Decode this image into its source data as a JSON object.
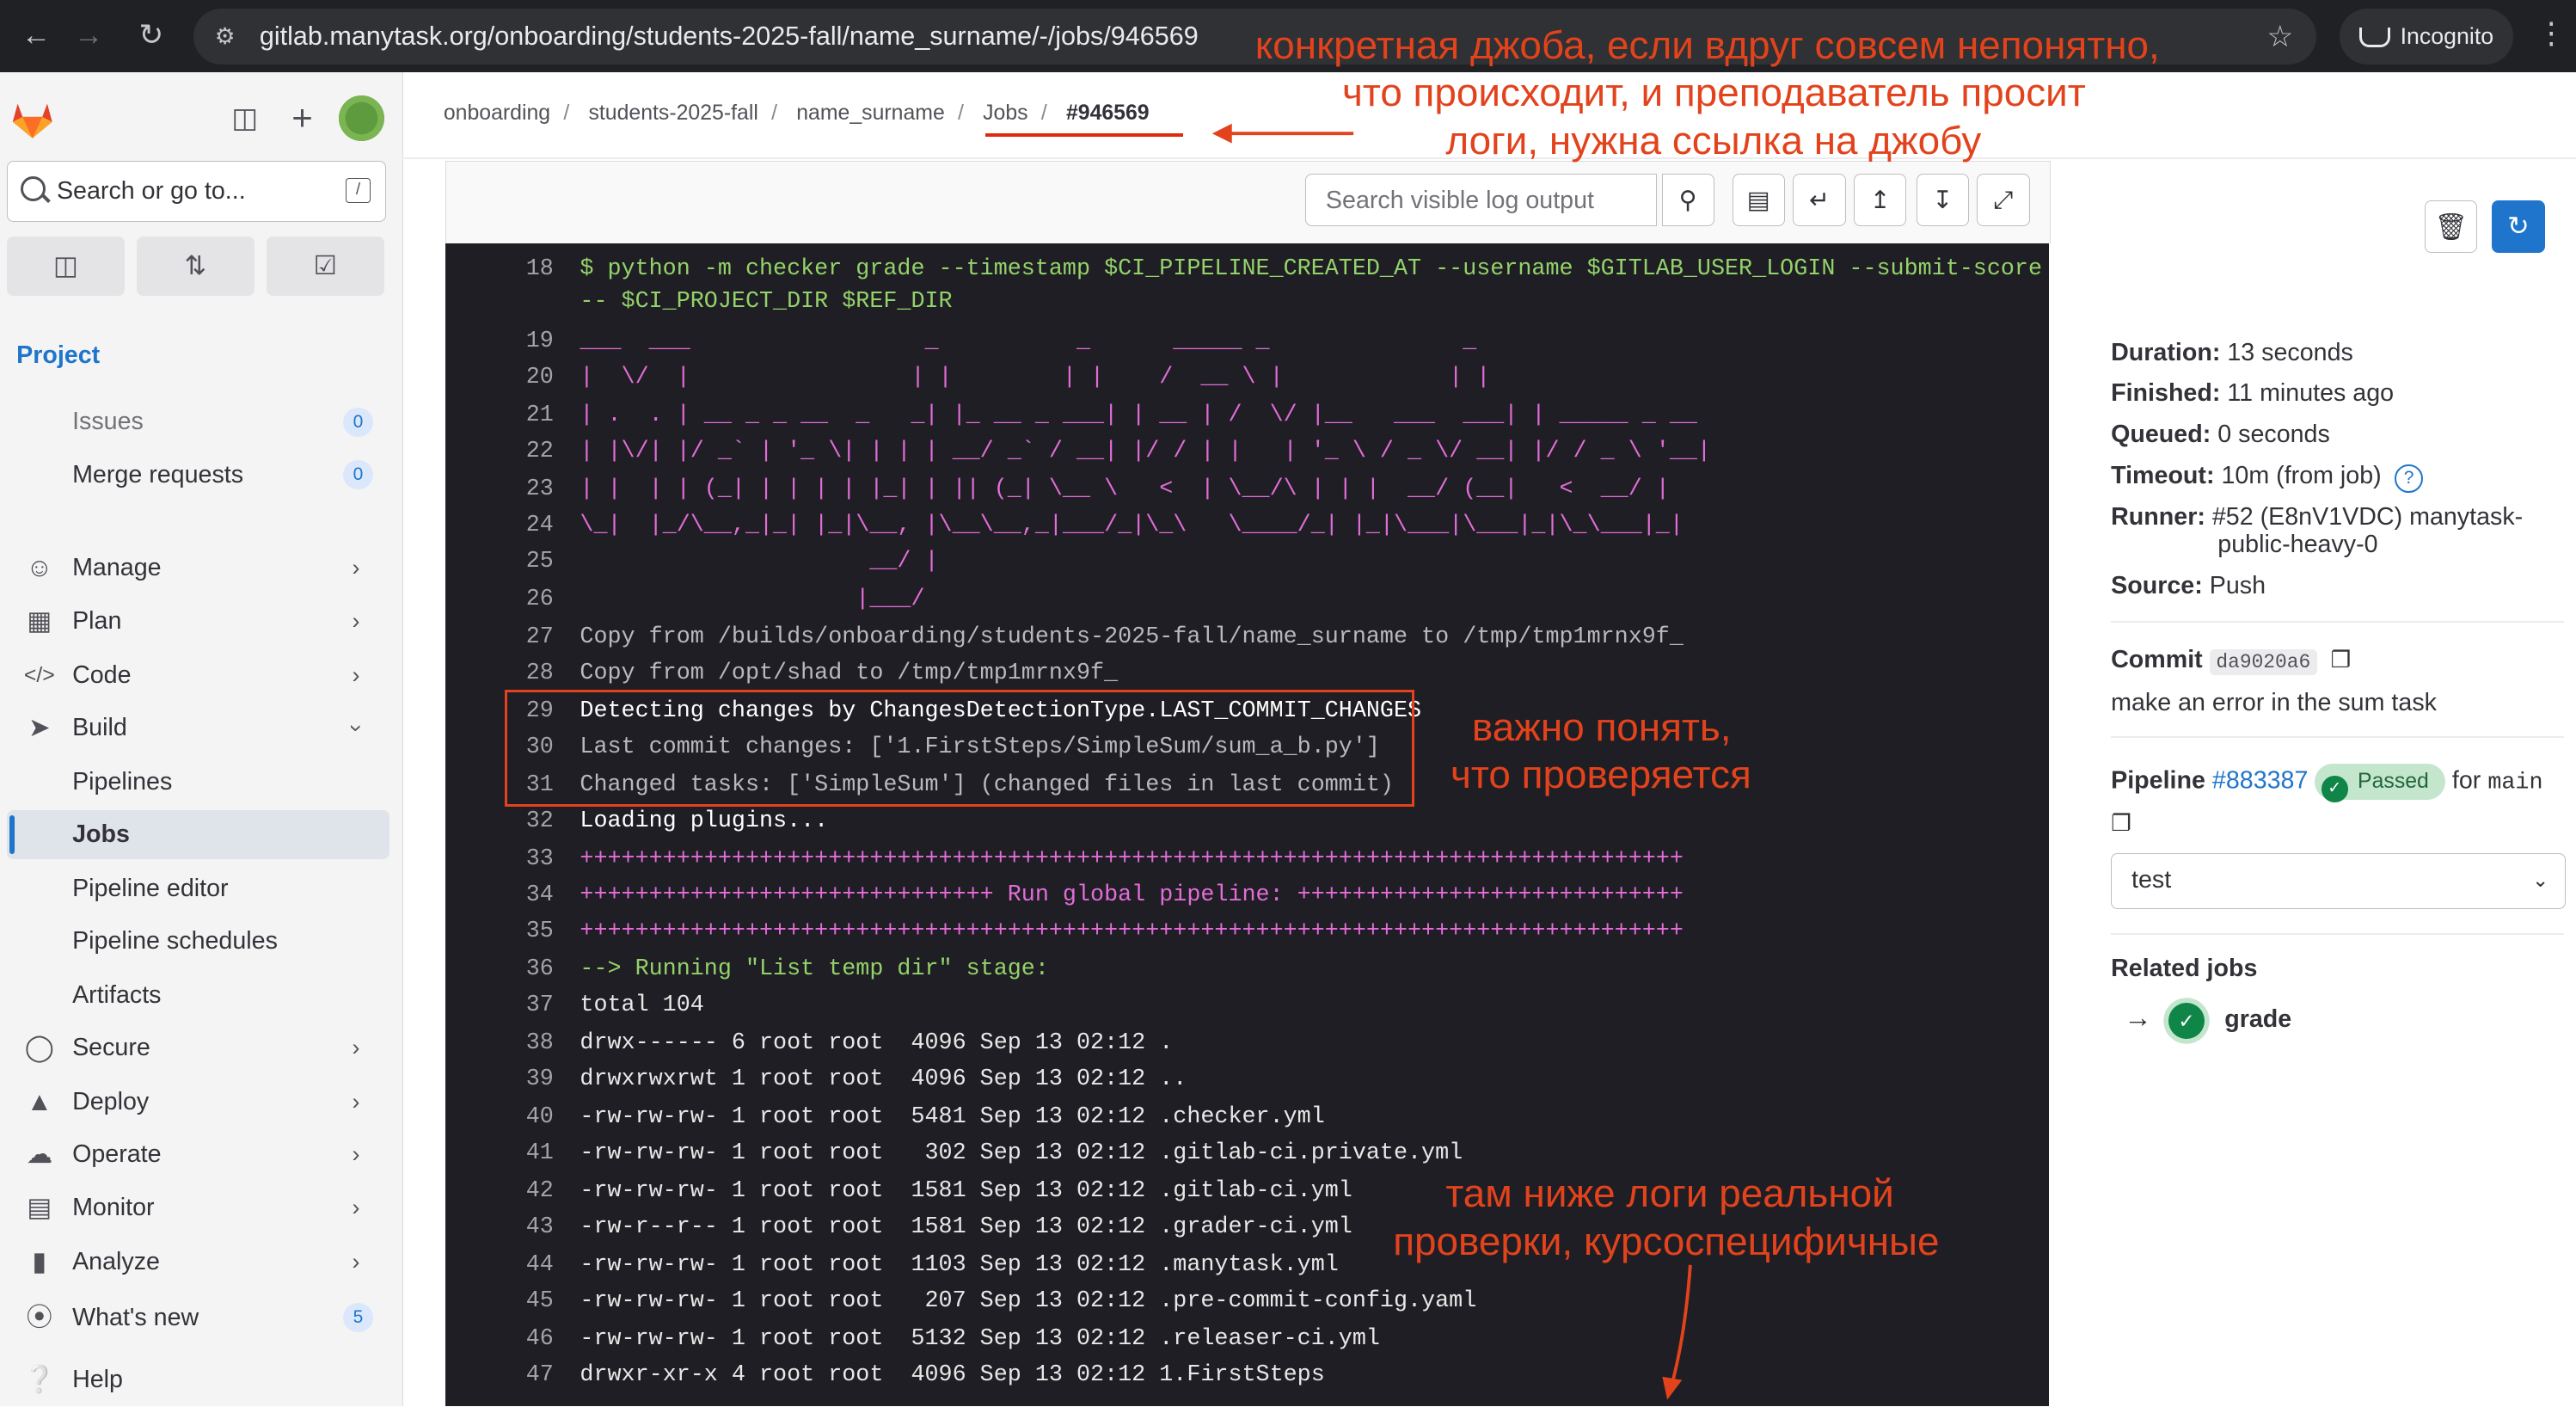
{
  "browser": {
    "url": "gitlab.manytask.org/onboarding/students-2025-fall/name_surname/-/jobs/946569",
    "profile_label": "Incognito"
  },
  "sidebar": {
    "search_placeholder": "Search or go to...",
    "search_shortcut": "/",
    "section_title": "Project",
    "items": [
      {
        "label": "Issues",
        "badge": "0"
      },
      {
        "label": "Merge requests",
        "badge": "0"
      },
      {
        "label": "Manage"
      },
      {
        "label": "Plan"
      },
      {
        "label": "Code"
      },
      {
        "label": "Build"
      },
      {
        "label": "Pipelines"
      },
      {
        "label": "Jobs"
      },
      {
        "label": "Pipeline editor"
      },
      {
        "label": "Pipeline schedules"
      },
      {
        "label": "Artifacts"
      },
      {
        "label": "Secure"
      },
      {
        "label": "Deploy"
      },
      {
        "label": "Operate"
      },
      {
        "label": "Monitor"
      },
      {
        "label": "Analyze"
      },
      {
        "label": "What's new",
        "badge": "5"
      },
      {
        "label": "Help"
      }
    ]
  },
  "breadcrumbs": [
    "onboarding",
    "students-2025-fall",
    "name_surname",
    "Jobs",
    "#946569"
  ],
  "log": {
    "search_placeholder": "Search visible log output",
    "lines": [
      {
        "n": "18",
        "text": "$ python -m checker grade --timestamp $CI_PIPELINE_CREATED_AT --username $GITLAB_USER_LOGIN --submit-score",
        "style": "green"
      },
      {
        "n": "",
        "text": "-- $CI_PROJECT_DIR $REF_DIR",
        "style": "green"
      },
      {
        "n": "19",
        "text": "___  ___                 _          _      _____ _              _",
        "style": "mag"
      },
      {
        "n": "20",
        "text": "|  \\/  |                | |        | |    /  __ \\ |            | |",
        "style": "mag"
      },
      {
        "n": "21",
        "text": "| .  . | __ _ _ __  _   _| |_ __ _ ___| | __ | /  \\/ |__   ___  ___| | _____ _ __",
        "style": "mag"
      },
      {
        "n": "22",
        "text": "| |\\/| |/ _` | '_ \\| | | | __/ _` / __| |/ / | |   | '_ \\ / _ \\/ __| |/ / _ \\ '__|",
        "style": "mag"
      },
      {
        "n": "23",
        "text": "| |  | | (_| | | | | |_| | || (_| \\__ \\   <  | \\__/\\ | | |  __/ (__|   <  __/ |",
        "style": "mag"
      },
      {
        "n": "24",
        "text": "\\_|  |_/\\__,_|_| |_|\\__, |\\__\\__,_|___/_|\\_\\   \\____/_| |_|\\___|\\___|_|\\_\\___|_|",
        "style": "mag"
      },
      {
        "n": "25",
        "text": "                     __/ |",
        "style": "mag"
      },
      {
        "n": "26",
        "text": "                    |___/",
        "style": "mag"
      },
      {
        "n": "27",
        "text": "Copy from /builds/onboarding/students-2025-fall/name_surname to /tmp/tmp1mrnx9f_",
        "style": "dim"
      },
      {
        "n": "28",
        "text": "Copy from /opt/shad to /tmp/tmp1mrnx9f_",
        "style": "dim"
      },
      {
        "n": "29",
        "text": "Detecting changes by ChangesDetectionType.LAST_COMMIT_CHANGES",
        "style": "bold"
      },
      {
        "n": "30",
        "text": "Last commit changes: ['1.FirstSteps/SimpleSum/sum_a_b.py']",
        "style": "dim"
      },
      {
        "n": "31",
        "text": "Changed tasks: ['SimpleSum'] (changed files in last commit)",
        "style": "dim"
      },
      {
        "n": "32",
        "text": "Loading plugins...",
        "style": "bold"
      },
      {
        "n": "33",
        "text": "++++++++++++++++++++++++++++++++++++++++++++++++++++++++++++++++++++++++++++++++",
        "style": "mag"
      },
      {
        "n": "34",
        "text": "++++++++++++++++++++++++++++++ Run global pipeline: ++++++++++++++++++++++++++++",
        "style": "mag"
      },
      {
        "n": "35",
        "text": "++++++++++++++++++++++++++++++++++++++++++++++++++++++++++++++++++++++++++++++++",
        "style": "mag"
      },
      {
        "n": "36",
        "text": "--> Running \"List temp dir\" stage:",
        "style": "green"
      },
      {
        "n": "37",
        "text": "total 104",
        "style": "normal"
      },
      {
        "n": "38",
        "text": "drwx------ 6 root root  4096 Sep 13 02:12 .",
        "style": "normal"
      },
      {
        "n": "39",
        "text": "drwxrwxrwt 1 root root  4096 Sep 13 02:12 ..",
        "style": "normal"
      },
      {
        "n": "40",
        "text": "-rw-rw-rw- 1 root root  5481 Sep 13 02:12 .checker.yml",
        "style": "normal"
      },
      {
        "n": "41",
        "text": "-rw-rw-rw- 1 root root   302 Sep 13 02:12 .gitlab-ci.private.yml",
        "style": "normal"
      },
      {
        "n": "42",
        "text": "-rw-rw-rw- 1 root root  1581 Sep 13 02:12 .gitlab-ci.yml",
        "style": "normal"
      },
      {
        "n": "43",
        "text": "-rw-r--r-- 1 root root  1581 Sep 13 02:12 .grader-ci.yml",
        "style": "normal"
      },
      {
        "n": "44",
        "text": "-rw-rw-rw- 1 root root  1103 Sep 13 02:12 .manytask.yml",
        "style": "normal"
      },
      {
        "n": "45",
        "text": "-rw-rw-rw- 1 root root   207 Sep 13 02:12 .pre-commit-config.yaml",
        "style": "normal"
      },
      {
        "n": "46",
        "text": "-rw-rw-rw- 1 root root  5132 Sep 13 02:12 .releaser-ci.yml",
        "style": "normal"
      },
      {
        "n": "47",
        "text": "drwxr-xr-x 4 root root  4096 Sep 13 02:12 1.FirstSteps",
        "style": "normal"
      }
    ]
  },
  "job": {
    "duration_label": "Duration:",
    "duration": "13 seconds",
    "finished_label": "Finished:",
    "finished": "11 minutes ago",
    "queued_label": "Queued:",
    "queued": "0 seconds",
    "timeout_label": "Timeout:",
    "timeout": "10m (from job)",
    "runner_label": "Runner:",
    "runner_1": "#52 (E8nV1VDC) manytask-",
    "runner_2": "public-heavy-0",
    "source_label": "Source:",
    "source": "Push",
    "commit_label": "Commit",
    "commit_sha": "da9020a6",
    "commit_message": "make an error in the sum task",
    "pipeline_label": "Pipeline",
    "pipeline_id": "#883387",
    "pipeline_status": "Passed",
    "pipeline_ref_prefix": "for",
    "pipeline_ref": "main",
    "stage_select": "test",
    "related_jobs_label": "Related jobs",
    "related_job": "grade"
  },
  "annotations": {
    "top_1": "конкретная джоба, если вдруг совсем непонятно,",
    "top_2": "что происходит, и преподаватель просит",
    "top_3": "логи, нужна ссылка на джобу",
    "mid_1": "важно понять,",
    "mid_2": "что проверяется",
    "bottom_1": "там ниже логи реальной",
    "bottom_2": "проверки, курсоспецифичные"
  },
  "colors": {
    "accent": "#1f75cb",
    "annotation": "#e2431c",
    "log_bg": "#1f1e24",
    "passed": "#108548"
  }
}
